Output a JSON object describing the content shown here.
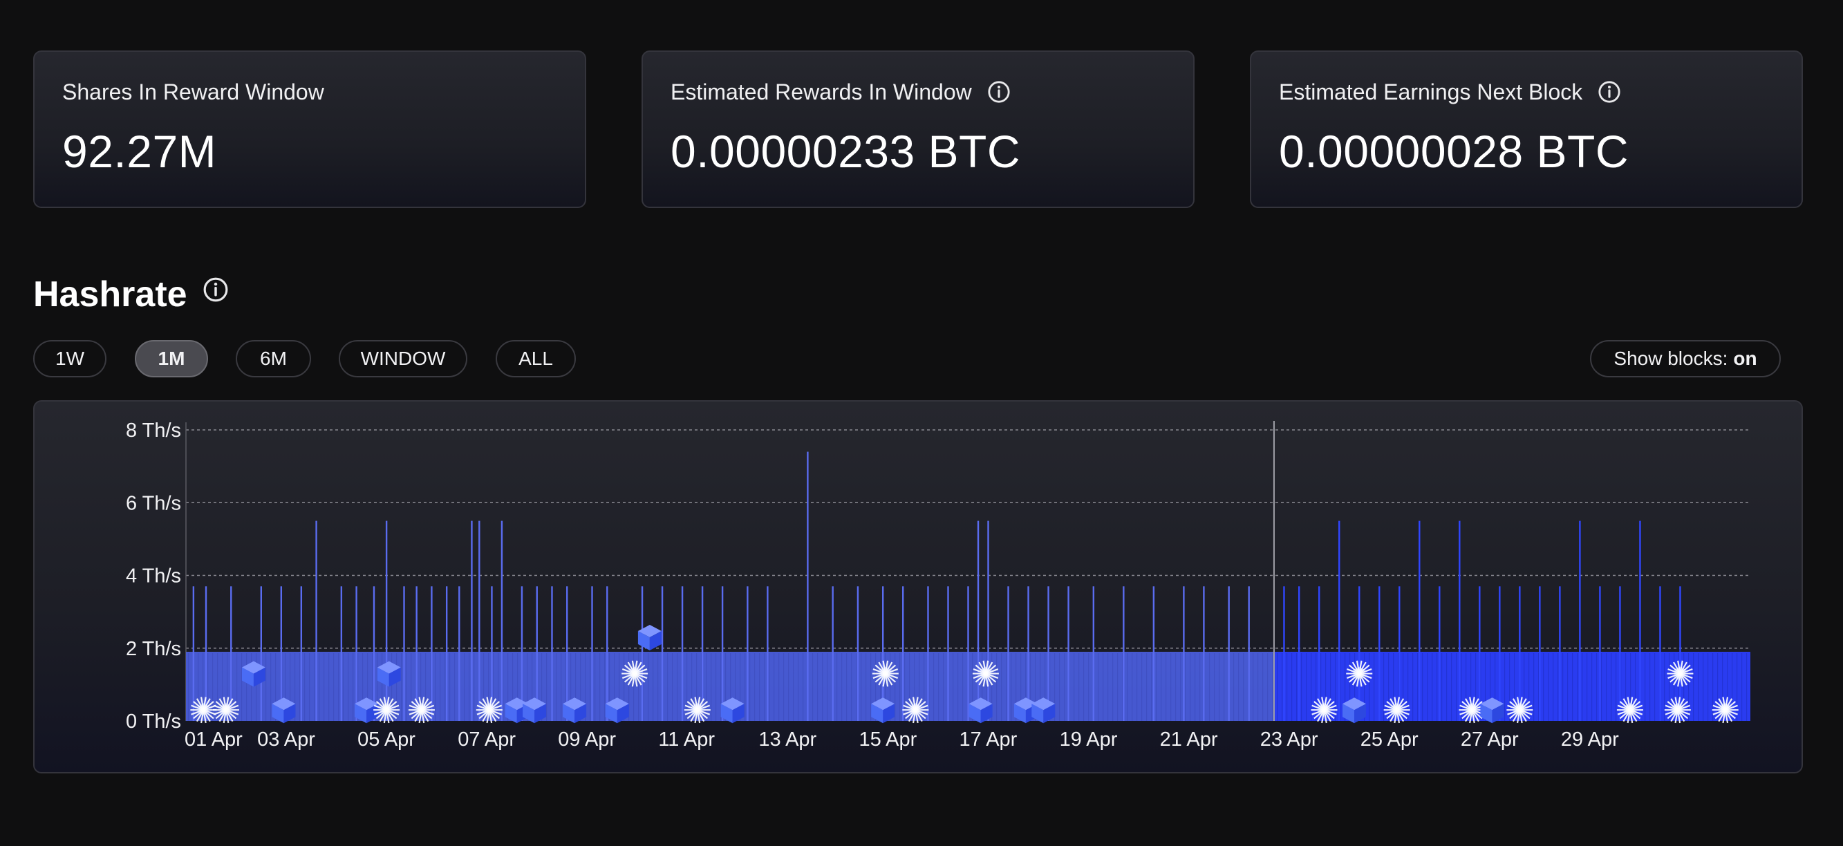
{
  "stats": [
    {
      "label": "Shares In Reward Window",
      "value": "92.27M",
      "info": false
    },
    {
      "label": "Estimated Rewards In Window",
      "value": "0.00000233 BTC",
      "info": true
    },
    {
      "label": "Estimated Earnings Next Block",
      "value": "0.00000028 BTC",
      "info": true
    }
  ],
  "hashrate": {
    "title": "Hashrate",
    "ranges": [
      "1W",
      "1M",
      "6M",
      "WINDOW",
      "ALL"
    ],
    "active_range": "1M",
    "show_blocks_label": "Show blocks:",
    "show_blocks_state": "on"
  },
  "colors": {
    "background": "#0f0f10",
    "bar": "#4b5ee0",
    "bar_window": "#2a3cf0",
    "block": "#4a6cf5"
  },
  "icons": {
    "info": "info-circle-icon",
    "block": "cube-icon",
    "found_block": "starburst-icon"
  },
  "chart_data": {
    "type": "bar",
    "unit": "Th/s",
    "y_ticks": [
      "0 Th/s",
      "2 Th/s",
      "4 Th/s",
      "6 Th/s",
      "8 Th/s"
    ],
    "ylim": [
      0,
      8
    ],
    "x_range_days": [
      1,
      31
    ],
    "x_tick_labels": [
      "01 Apr",
      "03 Apr",
      "05 Apr",
      "07 Apr",
      "09 Apr",
      "11 Apr",
      "13 Apr",
      "15 Apr",
      "17 Apr",
      "19 Apr",
      "21 Apr",
      "23 Apr",
      "25 Apr",
      "27 Apr",
      "29 Apr"
    ],
    "baseline_value": 1.9,
    "window_start_day": 22.7,
    "grid": "dashed horizontal",
    "spikes": [
      {
        "day": 1.15,
        "value": 3.7
      },
      {
        "day": 1.4,
        "value": 3.7
      },
      {
        "day": 1.9,
        "value": 3.7
      },
      {
        "day": 2.5,
        "value": 3.7
      },
      {
        "day": 2.9,
        "value": 3.7
      },
      {
        "day": 3.3,
        "value": 3.7
      },
      {
        "day": 3.6,
        "value": 5.5
      },
      {
        "day": 4.1,
        "value": 3.7
      },
      {
        "day": 4.4,
        "value": 3.7
      },
      {
        "day": 4.75,
        "value": 3.7
      },
      {
        "day": 5.0,
        "value": 5.5
      },
      {
        "day": 5.35,
        "value": 3.7
      },
      {
        "day": 5.6,
        "value": 3.7
      },
      {
        "day": 5.9,
        "value": 3.7
      },
      {
        "day": 6.2,
        "value": 3.7
      },
      {
        "day": 6.45,
        "value": 3.7
      },
      {
        "day": 6.7,
        "value": 5.5
      },
      {
        "day": 6.85,
        "value": 5.5
      },
      {
        "day": 7.1,
        "value": 3.7
      },
      {
        "day": 7.3,
        "value": 5.5
      },
      {
        "day": 7.7,
        "value": 3.7
      },
      {
        "day": 8.0,
        "value": 3.7
      },
      {
        "day": 8.3,
        "value": 3.7
      },
      {
        "day": 8.6,
        "value": 3.7
      },
      {
        "day": 9.1,
        "value": 3.7
      },
      {
        "day": 9.4,
        "value": 3.7
      },
      {
        "day": 10.1,
        "value": 3.7
      },
      {
        "day": 10.5,
        "value": 3.7
      },
      {
        "day": 10.9,
        "value": 3.7
      },
      {
        "day": 11.3,
        "value": 3.7
      },
      {
        "day": 11.7,
        "value": 3.7
      },
      {
        "day": 12.2,
        "value": 3.7
      },
      {
        "day": 12.6,
        "value": 3.7
      },
      {
        "day": 13.4,
        "value": 7.4
      },
      {
        "day": 13.9,
        "value": 3.7
      },
      {
        "day": 14.4,
        "value": 3.7
      },
      {
        "day": 14.9,
        "value": 3.7
      },
      {
        "day": 15.3,
        "value": 3.7
      },
      {
        "day": 15.8,
        "value": 3.7
      },
      {
        "day": 16.2,
        "value": 3.7
      },
      {
        "day": 16.6,
        "value": 3.7
      },
      {
        "day": 16.8,
        "value": 5.5
      },
      {
        "day": 17.0,
        "value": 5.5
      },
      {
        "day": 17.4,
        "value": 3.7
      },
      {
        "day": 17.8,
        "value": 3.7
      },
      {
        "day": 18.2,
        "value": 3.7
      },
      {
        "day": 18.6,
        "value": 3.7
      },
      {
        "day": 19.1,
        "value": 3.7
      },
      {
        "day": 19.7,
        "value": 3.7
      },
      {
        "day": 20.3,
        "value": 3.7
      },
      {
        "day": 20.9,
        "value": 3.7
      },
      {
        "day": 21.3,
        "value": 3.7
      },
      {
        "day": 21.8,
        "value": 3.7
      },
      {
        "day": 22.2,
        "value": 3.7
      },
      {
        "day": 22.9,
        "value": 3.7
      },
      {
        "day": 23.2,
        "value": 3.7
      },
      {
        "day": 23.6,
        "value": 3.7
      },
      {
        "day": 24.0,
        "value": 5.5
      },
      {
        "day": 24.4,
        "value": 3.7
      },
      {
        "day": 24.8,
        "value": 3.7
      },
      {
        "day": 25.2,
        "value": 3.7
      },
      {
        "day": 25.6,
        "value": 5.5
      },
      {
        "day": 26.0,
        "value": 3.7
      },
      {
        "day": 26.4,
        "value": 5.5
      },
      {
        "day": 26.8,
        "value": 3.7
      },
      {
        "day": 27.2,
        "value": 3.7
      },
      {
        "day": 27.6,
        "value": 3.7
      },
      {
        "day": 28.0,
        "value": 3.7
      },
      {
        "day": 28.4,
        "value": 3.7
      },
      {
        "day": 28.8,
        "value": 5.5
      },
      {
        "day": 29.2,
        "value": 3.7
      },
      {
        "day": 29.6,
        "value": 3.7
      },
      {
        "day": 30.0,
        "value": 5.5
      },
      {
        "day": 30.4,
        "value": 3.7
      },
      {
        "day": 30.8,
        "value": 3.7
      }
    ],
    "blocks": [
      {
        "day": 1.35,
        "kind": "found",
        "level": 0.3
      },
      {
        "day": 1.8,
        "kind": "found",
        "level": 0.3
      },
      {
        "day": 2.35,
        "kind": "cube",
        "level": 1.3
      },
      {
        "day": 2.95,
        "kind": "cube",
        "level": 0.3
      },
      {
        "day": 4.6,
        "kind": "cube",
        "level": 0.3
      },
      {
        "day": 5.0,
        "kind": "found",
        "level": 0.3
      },
      {
        "day": 5.05,
        "kind": "cube",
        "level": 1.3
      },
      {
        "day": 5.7,
        "kind": "found",
        "level": 0.3
      },
      {
        "day": 7.05,
        "kind": "found",
        "level": 0.3
      },
      {
        "day": 7.6,
        "kind": "cube",
        "level": 0.3
      },
      {
        "day": 7.95,
        "kind": "cube",
        "level": 0.3
      },
      {
        "day": 8.75,
        "kind": "cube",
        "level": 0.3
      },
      {
        "day": 9.6,
        "kind": "cube",
        "level": 0.3
      },
      {
        "day": 9.95,
        "kind": "found",
        "level": 1.3
      },
      {
        "day": 10.25,
        "kind": "cube",
        "level": 2.3
      },
      {
        "day": 11.2,
        "kind": "found",
        "level": 0.3
      },
      {
        "day": 11.9,
        "kind": "cube",
        "level": 0.3
      },
      {
        "day": 14.9,
        "kind": "cube",
        "level": 0.3
      },
      {
        "day": 14.95,
        "kind": "found",
        "level": 1.3
      },
      {
        "day": 15.55,
        "kind": "found",
        "level": 0.3
      },
      {
        "day": 16.85,
        "kind": "cube",
        "level": 0.3
      },
      {
        "day": 16.95,
        "kind": "found",
        "level": 1.3
      },
      {
        "day": 17.75,
        "kind": "cube",
        "level": 0.3
      },
      {
        "day": 18.1,
        "kind": "cube",
        "level": 0.3
      },
      {
        "day": 23.7,
        "kind": "found",
        "level": 0.3
      },
      {
        "day": 24.3,
        "kind": "cube",
        "level": 0.3
      },
      {
        "day": 24.4,
        "kind": "found",
        "level": 1.3
      },
      {
        "day": 25.15,
        "kind": "found",
        "level": 0.3
      },
      {
        "day": 26.65,
        "kind": "found",
        "level": 0.3
      },
      {
        "day": 27.05,
        "kind": "cube",
        "level": 0.3
      },
      {
        "day": 27.6,
        "kind": "found",
        "level": 0.3
      },
      {
        "day": 29.8,
        "kind": "found",
        "level": 0.3
      },
      {
        "day": 30.75,
        "kind": "found",
        "level": 0.3
      },
      {
        "day": 30.8,
        "kind": "found",
        "level": 1.3
      },
      {
        "day": 31.7,
        "kind": "found",
        "level": 0.3
      }
    ]
  }
}
